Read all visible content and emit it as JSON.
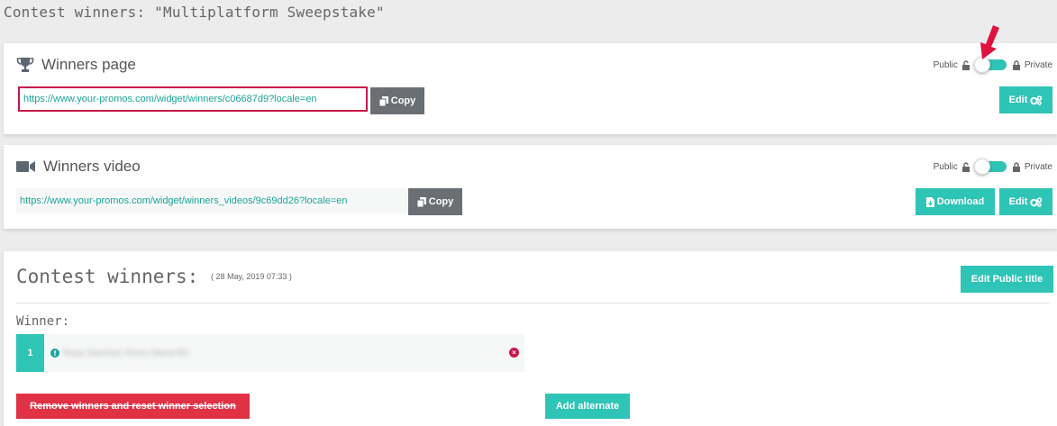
{
  "page": {
    "title": "Contest winners: \"Multiplatform Sweepstake\""
  },
  "winners_page": {
    "title": "Winners page",
    "icon": "trophy-icon",
    "public_label": "Public",
    "private_label": "Private",
    "url": "https://www.your-promos.com/widget/winners/c06687d9?locale=en",
    "copy_label": "Copy",
    "edit_label": "Edit"
  },
  "winners_video": {
    "title": "Winners video",
    "icon": "video-camera-icon",
    "public_label": "Public",
    "private_label": "Private",
    "url": "https://www.your-promos.com/widget/winners_videos/9c69dd26?locale=en",
    "copy_label": "Copy",
    "download_label": "Download",
    "edit_label": "Edit"
  },
  "contest_winners": {
    "title": "Contest winners:",
    "date": "( 28 May, 2019 07:33 )",
    "edit_public_title_label": "Edit Public title",
    "winner_label": "Winner:",
    "winners": [
      {
        "rank": "1",
        "name": "Rosa Sánchez Torres Mena RC"
      }
    ],
    "remove_label": "Remove winners and reset winner selection",
    "add_alternate_label": "Add alternate"
  },
  "colors": {
    "accent": "#2ec4b6",
    "danger": "#e03145",
    "highlight": "#c8174b",
    "neutral": "#6b6f74"
  }
}
